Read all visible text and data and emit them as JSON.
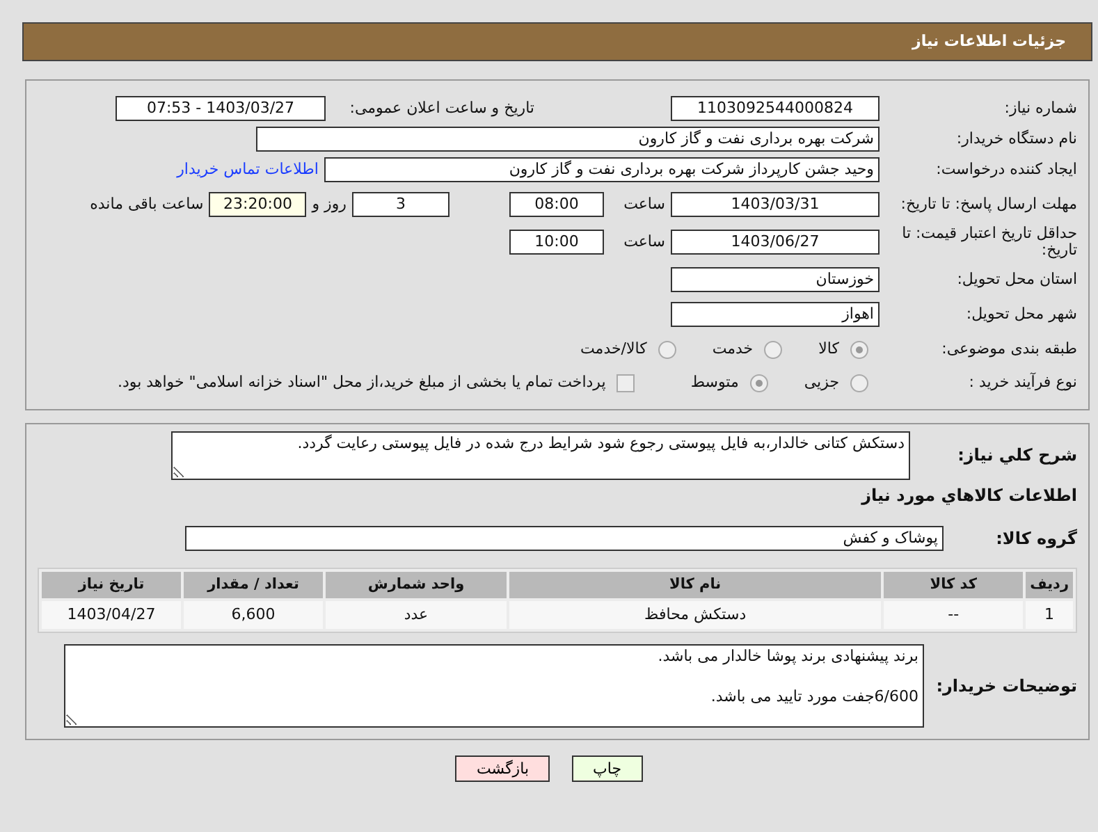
{
  "header": {
    "title": "جزئیات اطلاعات نیاز"
  },
  "need_number": {
    "label": "شماره نیاز:",
    "value": "1103092544000824"
  },
  "announce": {
    "label": "تاریخ و ساعت اعلان عمومی:",
    "value": "1403/03/27 - 07:53"
  },
  "buyer_org": {
    "label": "نام دستگاه خریدار:",
    "value": "شرکت بهره برداری نفت و گاز کارون"
  },
  "requester": {
    "label": "ایجاد کننده درخواست:",
    "value": "وحید جشن کارپرداز شرکت بهره برداری نفت و گاز کارون",
    "link": "اطلاعات تماس خریدار"
  },
  "deadline": {
    "label": "مهلت ارسال پاسخ: تا تاریخ:",
    "date": "1403/03/31",
    "time_label": "ساعت",
    "time": "08:00",
    "days": "3",
    "days_label": "روز و",
    "remaining": "23:20:00",
    "remaining_label": "ساعت باقی مانده"
  },
  "validity": {
    "label": "حداقل تاریخ اعتبار قیمت: تا تاریخ:",
    "date": "1403/06/27",
    "time_label": "ساعت",
    "time": "10:00"
  },
  "province": {
    "label": "استان محل تحویل:",
    "value": "خوزستان"
  },
  "city": {
    "label": "شهر محل تحویل:",
    "value": "اهواز"
  },
  "category": {
    "label": "طبقه بندی موضوعی:",
    "options": [
      {
        "label": "کالا",
        "selected": true
      },
      {
        "label": "خدمت",
        "selected": false
      },
      {
        "label": "کالا/خدمت",
        "selected": false
      }
    ]
  },
  "process": {
    "label": "نوع فرآیند خرید :",
    "options": [
      {
        "label": "جزیی",
        "selected": false
      },
      {
        "label": "متوسط",
        "selected": true
      }
    ],
    "payment": {
      "label": "پرداخت تمام یا بخشی از مبلغ خرید،از محل \"اسناد خزانه اسلامی\" خواهد بود.",
      "checked": false
    }
  },
  "description": {
    "label": "شرح کلي نياز:",
    "value": "دستکش کتانی خالدار،به فایل پیوستی رجوع شود شرایط درج شده در فایل پیوستی رعایت گردد."
  },
  "goods_title": "اطلاعات کالاهاي مورد نياز",
  "goods_group": {
    "label": "گروه کالا:",
    "value": "پوشاک و کفش"
  },
  "table": {
    "columns": [
      "ردیف",
      "کد کالا",
      "نام کالا",
      "واحد شمارش",
      "تعداد / مقدار",
      "تاریخ نیاز"
    ],
    "rows": [
      [
        "1",
        "--",
        "دستکش محافظ",
        "عدد",
        "6,600",
        "1403/04/27"
      ]
    ]
  },
  "buyer_notes": {
    "label": "توضیحات خریدار:",
    "value": "برند پیشنهادی برند پوشا خالدار می باشد.\n\n6/600جفت مورد تایید می باشد."
  },
  "buttons": [
    {
      "label": "چاپ",
      "kind": "print"
    },
    {
      "label": "بازگشت",
      "kind": "back"
    }
  ]
}
